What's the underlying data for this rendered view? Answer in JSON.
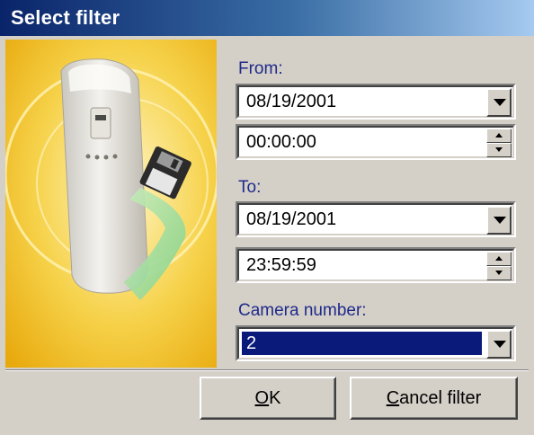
{
  "window": {
    "title": "Select filter"
  },
  "colors": {
    "title_gradient_start": "#0a246a",
    "title_gradient_end": "#a6caf0",
    "label_color": "#1f2a8a",
    "selection_bg": "#0a1a7a",
    "dialog_bg": "#d4d0c8"
  },
  "illustration": {
    "icon": "motion-sensor-with-floppy-disk"
  },
  "from": {
    "label": "From:",
    "date": "08/19/2001",
    "time": "00:00:00"
  },
  "to": {
    "label": "To:",
    "date": "08/19/2001",
    "time": "23:59:59"
  },
  "camera": {
    "label": "Camera number:",
    "value": "2"
  },
  "buttons": {
    "ok_mnemonic": "O",
    "ok_rest": "K",
    "cancel_mnemonic": "C",
    "cancel_rest": "ancel filter"
  }
}
